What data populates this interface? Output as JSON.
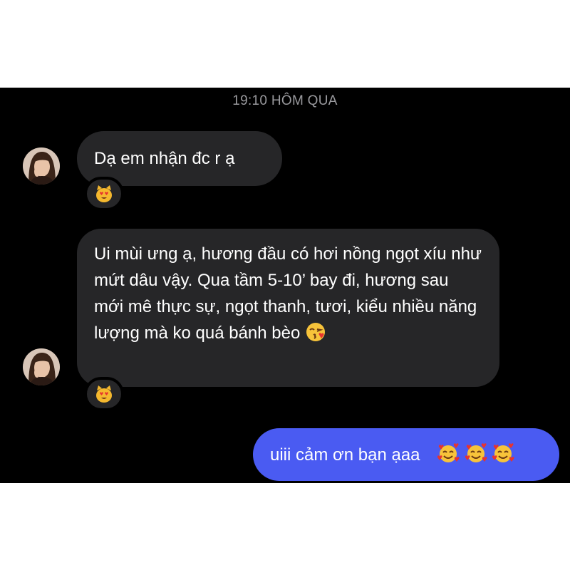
{
  "conversation": {
    "timestamp": "19:10 HÔM QUA"
  },
  "messages": [
    {
      "sender": "them",
      "text": "Dạ em nhận đc r ạ",
      "reaction": "heart-eyes-cat-emoji"
    },
    {
      "sender": "them",
      "text": "Ui mùi ưng ạ, hương đầu có hơi nồng ngọt xíu như mứt dâu vậy. Qua tầm 5-10’ bay đi, hương sau mới mê thực sự, ngọt thanh, tươi, kiểu nhiều năng lượng mà ko quá bánh bèo",
      "trailing_emoji": "face-blowing-kiss-emoji",
      "reaction": "heart-eyes-cat-emoji"
    },
    {
      "sender": "me",
      "text": "uiii cảm ơn bạn ạaa",
      "trailing_emojis": [
        "smiling-face-with-hearts-emoji",
        "smiling-face-with-hearts-emoji",
        "smiling-face-with-hearts-emoji"
      ]
    }
  ],
  "colors": {
    "background": "#000000",
    "incoming_bubble": "#262628",
    "outgoing_bubble": "#4a5bf2",
    "timestamp_text": "#9a9a9e"
  }
}
